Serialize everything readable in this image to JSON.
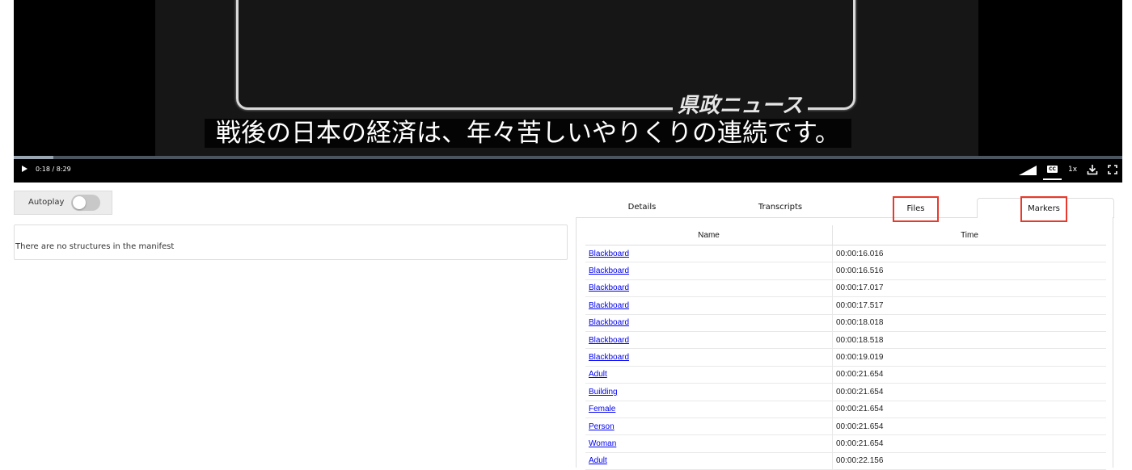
{
  "player": {
    "subtitle": "戦後の日本の経済は、年々苦しいやりくりの連続です。",
    "logo_text": "県政ニュース",
    "time_display": "0:18 / 8:29",
    "progress_fraction": 0.036,
    "speed": "1x",
    "cc_label": "CC",
    "icons": [
      "play-icon",
      "volume-icon",
      "captions-icon",
      "download-icon",
      "fullscreen-icon"
    ]
  },
  "autoplay": {
    "label": "Autoplay",
    "enabled": false
  },
  "structure": {
    "message": "There are no structures in the manifest"
  },
  "tabs": [
    {
      "label": "Details"
    },
    {
      "label": "Transcripts"
    },
    {
      "label": "Files"
    },
    {
      "label": "Markers"
    }
  ],
  "markers": {
    "columns": {
      "name": "Name",
      "time": "Time"
    },
    "rows": [
      {
        "name": "Blackboard",
        "time": "00:00:16.016"
      },
      {
        "name": "Blackboard",
        "time": "00:00:16.516"
      },
      {
        "name": "Blackboard",
        "time": "00:00:17.017"
      },
      {
        "name": "Blackboard",
        "time": "00:00:17.517"
      },
      {
        "name": "Blackboard",
        "time": "00:00:18.018"
      },
      {
        "name": "Blackboard",
        "time": "00:00:18.518"
      },
      {
        "name": "Blackboard",
        "time": "00:00:19.019"
      },
      {
        "name": "Adult",
        "time": "00:00:21.654"
      },
      {
        "name": "Building",
        "time": "00:00:21.654"
      },
      {
        "name": "Female",
        "time": "00:00:21.654"
      },
      {
        "name": "Person",
        "time": "00:00:21.654"
      },
      {
        "name": "Woman",
        "time": "00:00:21.654"
      },
      {
        "name": "Adult",
        "time": "00:00:22.156"
      }
    ]
  },
  "colors": {
    "highlight": "#e8392c",
    "link": "#0000ee",
    "player_bg": "#000000"
  }
}
